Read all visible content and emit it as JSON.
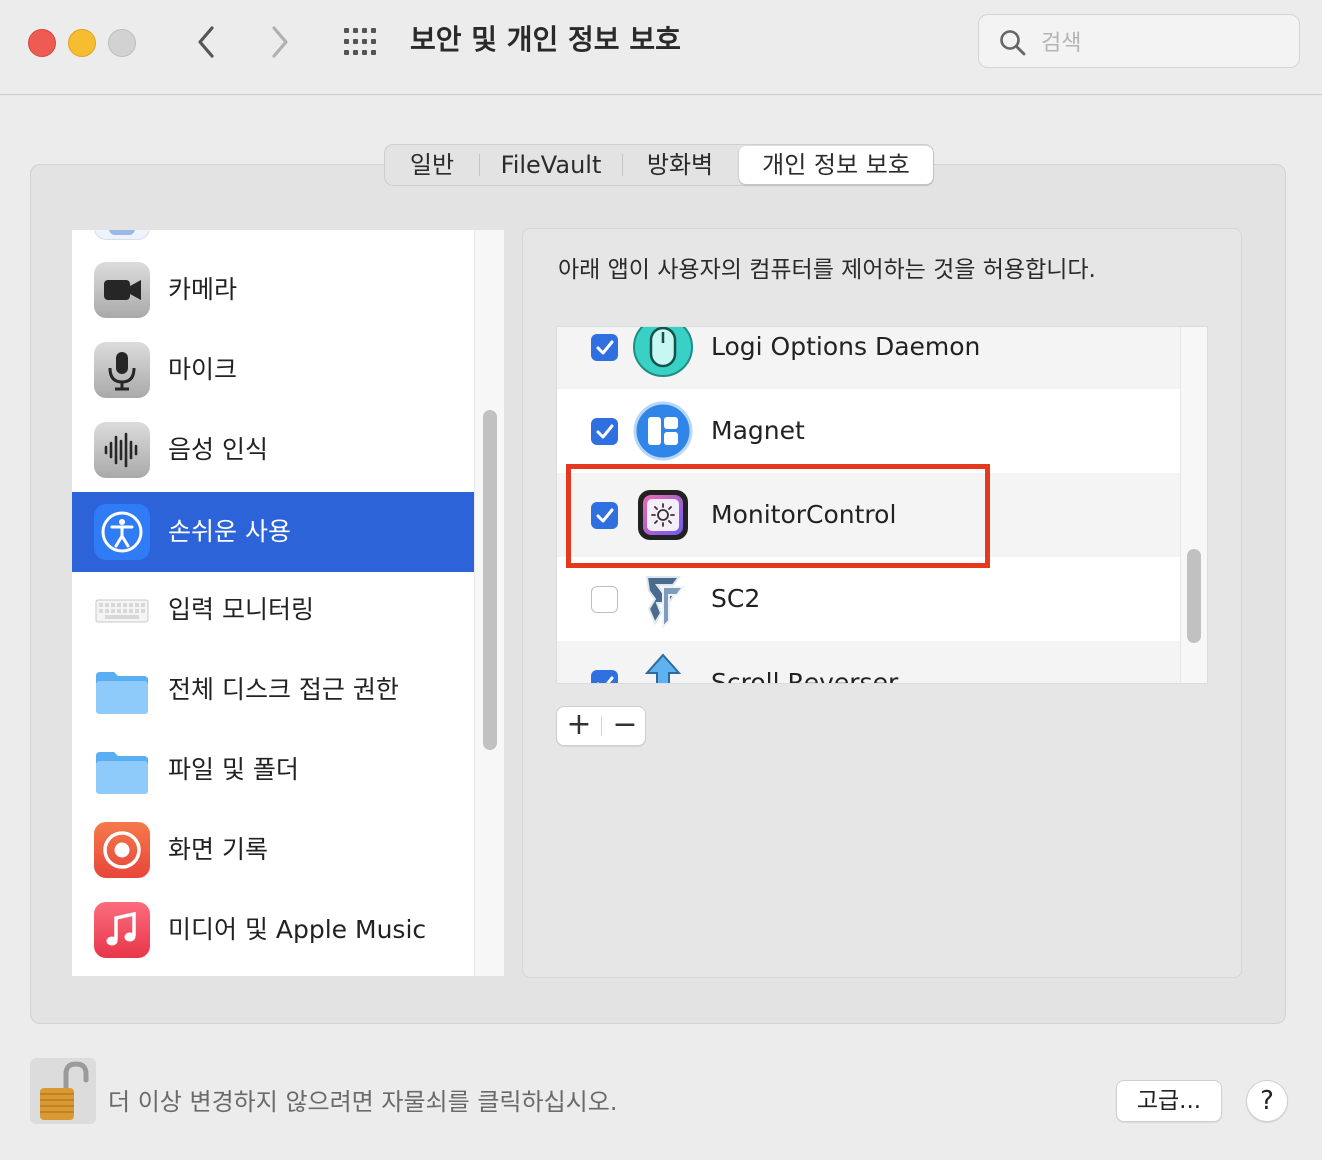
{
  "window": {
    "title": "보안 및 개인 정보 보호",
    "search_placeholder": "검색"
  },
  "tabs": [
    {
      "label": "일반"
    },
    {
      "label": "FileVault"
    },
    {
      "label": "방화벽"
    },
    {
      "label": "개인 정보 보호",
      "selected": true
    }
  ],
  "sidebar": {
    "items": [
      {
        "label": "카메라",
        "icon": "camera-icon"
      },
      {
        "label": "마이크",
        "icon": "microphone-icon"
      },
      {
        "label": "음성 인식",
        "icon": "waveform-icon"
      },
      {
        "label": "손쉬운 사용",
        "icon": "accessibility-icon",
        "selected": true
      },
      {
        "label": "입력 모니터링",
        "icon": "keyboard-icon"
      },
      {
        "label": "전체 디스크 접근 권한",
        "icon": "folder-icon"
      },
      {
        "label": "파일 및 폴더",
        "icon": "folder-icon"
      },
      {
        "label": "화면 기록",
        "icon": "screen-record-icon"
      },
      {
        "label": "미디어 및 Apple Music",
        "icon": "music-icon"
      }
    ]
  },
  "main": {
    "description": "아래 앱이 사용자의 컴퓨터를 제어하는 것을 허용합니다.",
    "apps": [
      {
        "name": "Logi Options Daemon",
        "checked": true,
        "icon": "mouse-icon"
      },
      {
        "name": "Magnet",
        "checked": true,
        "icon": "magnet-app-icon"
      },
      {
        "name": "MonitorControl",
        "checked": true,
        "icon": "brightness-icon",
        "highlighted": true
      },
      {
        "name": "SC2",
        "checked": false,
        "icon": "starcraft-icon"
      },
      {
        "name": "Scroll Reverser",
        "checked": true,
        "icon": "scroll-arrow-icon"
      }
    ],
    "add_label": "+",
    "remove_label": "−"
  },
  "footer": {
    "lock_text": "더 이상 변경하지 않으려면 자물쇠를 클릭하십시오.",
    "advanced_label": "고급...",
    "help_label": "?"
  },
  "colors": {
    "accent": "#2d63d9",
    "checkbox": "#2f6fe0",
    "highlight_border": "#e5391f"
  }
}
